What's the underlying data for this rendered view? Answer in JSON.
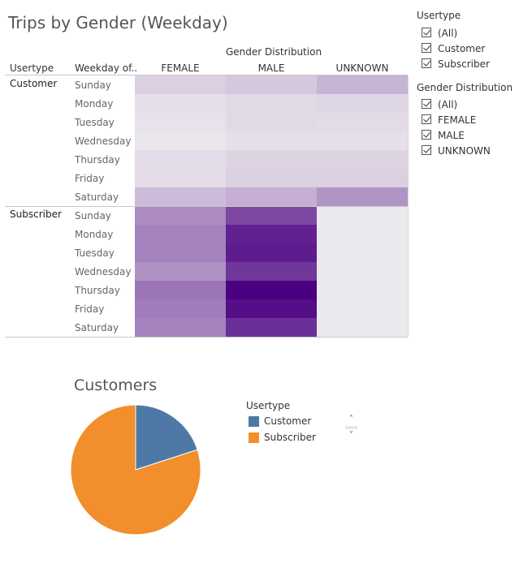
{
  "title": "Trips by Gender (Weekday)",
  "table": {
    "gender_header": "Gender Distribution",
    "col_usertype": "Usertype",
    "col_weekday": "Weekday of..",
    "columns": [
      "FEMALE",
      "MALE",
      "UNKNOWN"
    ],
    "groups": [
      {
        "label": "Customer",
        "days": [
          "Sunday",
          "Monday",
          "Tuesday",
          "Wednesday",
          "Thursday",
          "Friday",
          "Saturday"
        ]
      },
      {
        "label": "Subscriber",
        "days": [
          "Sunday",
          "Monday",
          "Tuesday",
          "Wednesday",
          "Thursday",
          "Friday",
          "Saturday"
        ]
      }
    ]
  },
  "chart_data": [
    {
      "type": "heatmap",
      "title": "Trips by Gender (Weekday)",
      "x_header": "Gender Distribution",
      "x": [
        "FEMALE",
        "MALE",
        "UNKNOWN"
      ],
      "y": [
        "Customer / Sunday",
        "Customer / Monday",
        "Customer / Tuesday",
        "Customer / Wednesday",
        "Customer / Thursday",
        "Customer / Friday",
        "Customer / Saturday",
        "Subscriber / Sunday",
        "Subscriber / Monday",
        "Subscriber / Tuesday",
        "Subscriber / Wednesday",
        "Subscriber / Thursday",
        "Subscriber / Friday",
        "Subscriber / Saturday"
      ],
      "intensity": [
        [
          0.1,
          0.13,
          0.2
        ],
        [
          0.05,
          0.07,
          0.08
        ],
        [
          0.04,
          0.07,
          0.06
        ],
        [
          0.03,
          0.05,
          0.05
        ],
        [
          0.06,
          0.09,
          0.09
        ],
        [
          0.06,
          0.1,
          0.1
        ],
        [
          0.17,
          0.22,
          0.33
        ],
        [
          0.36,
          0.66,
          0.02
        ],
        [
          0.4,
          0.84,
          0.02
        ],
        [
          0.4,
          0.86,
          0.02
        ],
        [
          0.34,
          0.74,
          0.02
        ],
        [
          0.46,
          1.0,
          0.02
        ],
        [
          0.43,
          0.93,
          0.02
        ],
        [
          0.4,
          0.77,
          0.02
        ]
      ],
      "color_scale": [
        "#f2f2f2",
        "#4a0080"
      ]
    },
    {
      "type": "pie",
      "title": "Customers",
      "legend_title": "Usertype",
      "legend_position": "right",
      "labels": [
        "Customer",
        "Subscriber"
      ],
      "values": [
        20,
        80
      ],
      "colors": [
        "#4e79a7",
        "#f28e2b"
      ]
    }
  ],
  "filters": {
    "usertype": {
      "title": "Usertype",
      "items": [
        "(All)",
        "Customer",
        "Subscriber"
      ]
    },
    "gender": {
      "title": "Gender Distribution",
      "items": [
        "(All)",
        "FEMALE",
        "MALE",
        "UNKNOWN"
      ]
    }
  },
  "legend": {
    "scroll_up_icon": "chevron-up-icon",
    "scroll_down_icon": "chevron-down-icon"
  }
}
